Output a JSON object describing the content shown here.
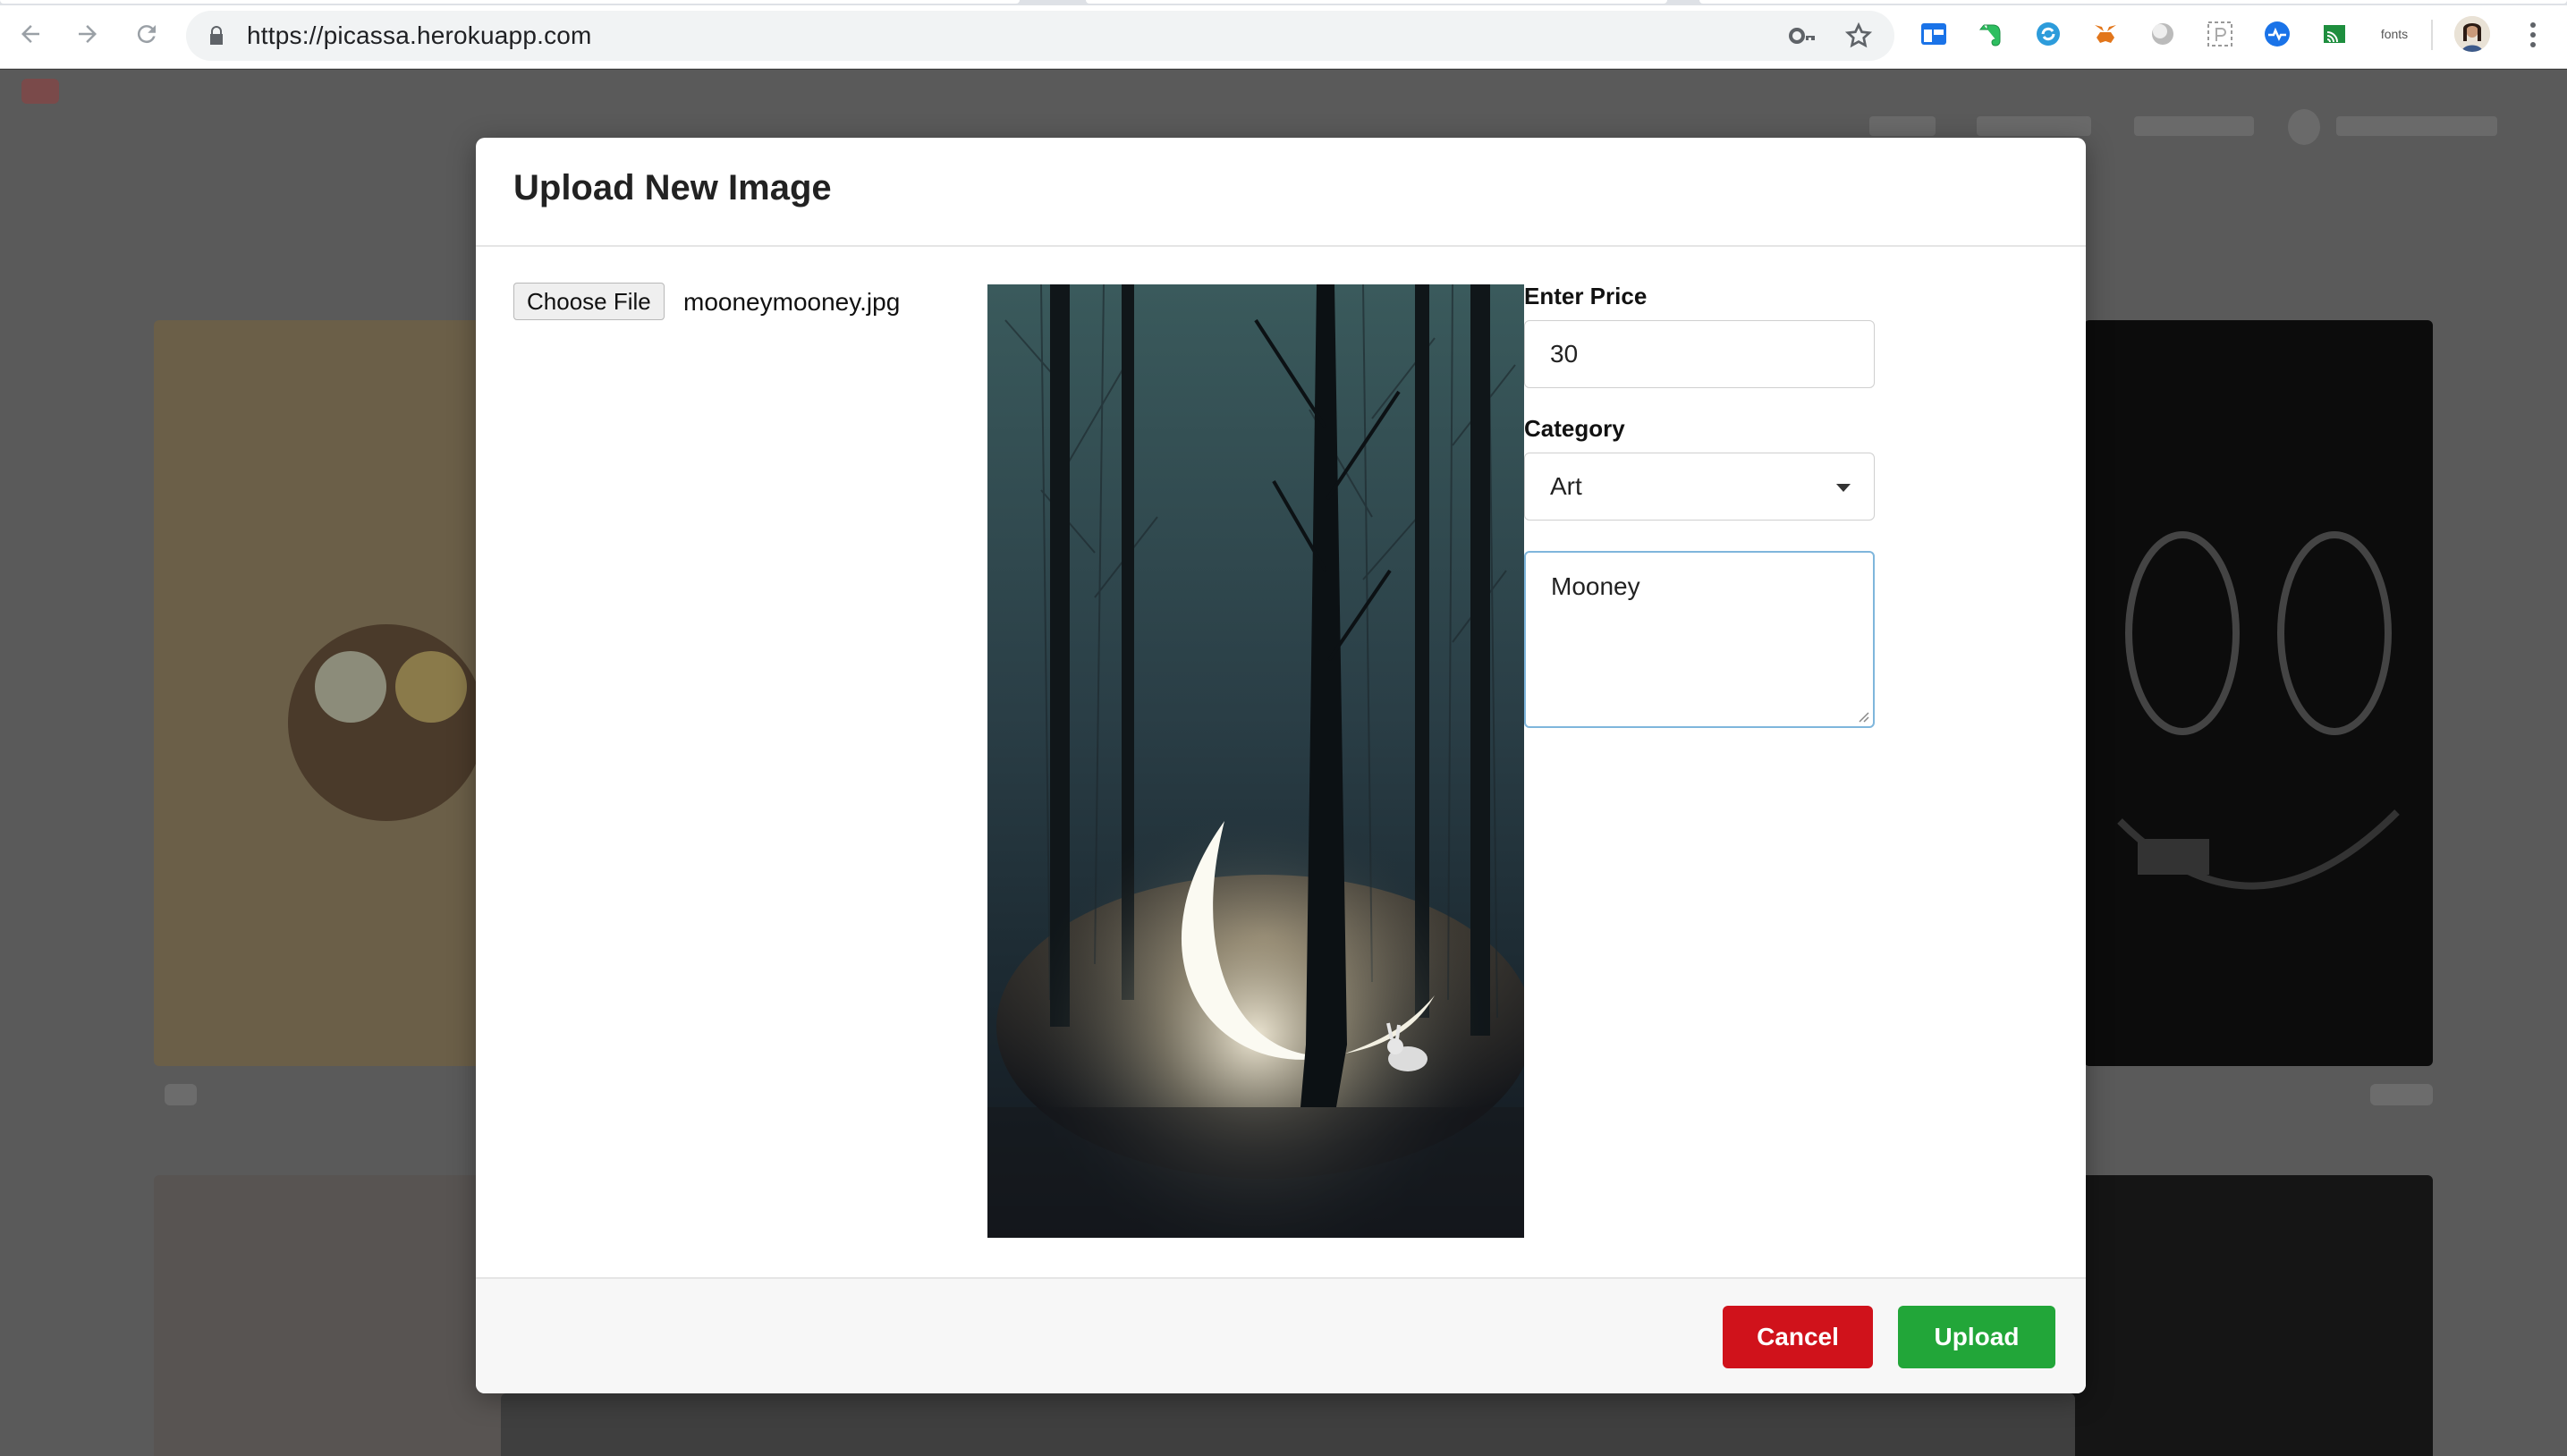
{
  "browser": {
    "url": "https://picassa.herokuapp.com",
    "extensions": [
      "window-icon",
      "evernote-icon",
      "sync-icon",
      "metamask-icon",
      "circle-icon",
      "dashed-box-icon",
      "pulse-icon",
      "cast-icon",
      "fonts"
    ],
    "fonts_label": "fonts"
  },
  "modal": {
    "title": "Upload New Image",
    "file": {
      "button_label": "Choose File",
      "selected_name": "mooneymooney.jpg"
    },
    "price": {
      "label": "Enter Price",
      "value": "30"
    },
    "category": {
      "label": "Category",
      "selected": "Art"
    },
    "description": {
      "value": "Mooney"
    },
    "footer": {
      "cancel_label": "Cancel",
      "upload_label": "Upload"
    }
  },
  "colors": {
    "cancel": "#d0121b",
    "upload": "#22a639",
    "focus_border": "#7fb6dc"
  }
}
